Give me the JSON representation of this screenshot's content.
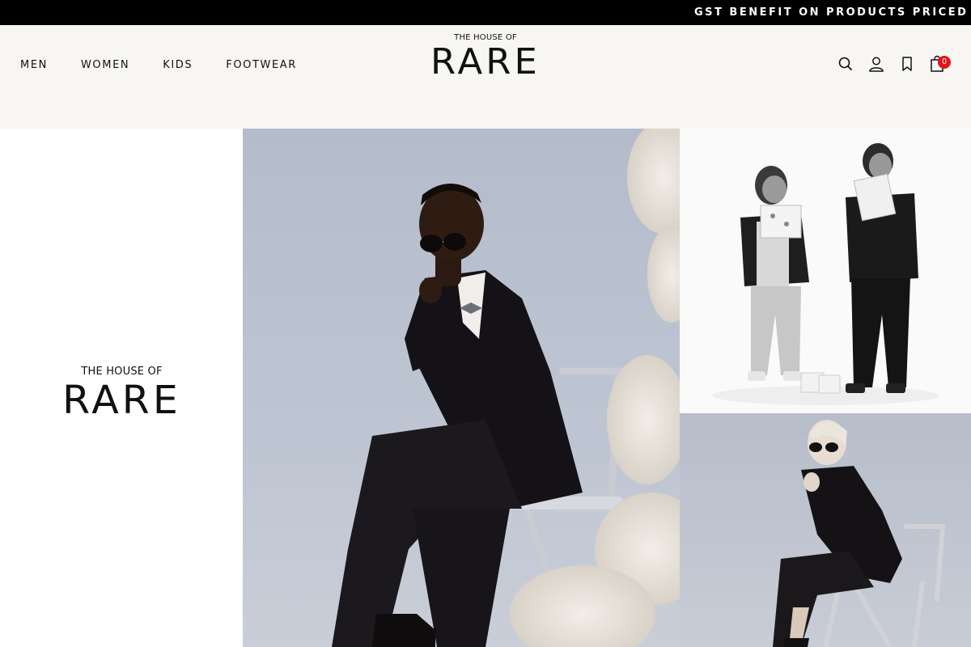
{
  "announcement": {
    "text": "GST BENEFIT ON PRODUCTS PRICED BE"
  },
  "header": {
    "nav": [
      "MEN",
      "WOMEN",
      "KIDS",
      "FOOTWEAR"
    ],
    "logo": {
      "small": "THE HOUSE OF",
      "big": "RARE"
    },
    "icons": [
      "search-icon",
      "account-icon",
      "wishlist-icon",
      "cart-icon"
    ],
    "cart_count": "0"
  },
  "brand_panel": {
    "small": "THE HOUSE OF",
    "big": "RARE"
  },
  "colors": {
    "announcement_bg": "#000000",
    "header_bg": "#f7f6f2",
    "badge": "#e3141b"
  }
}
